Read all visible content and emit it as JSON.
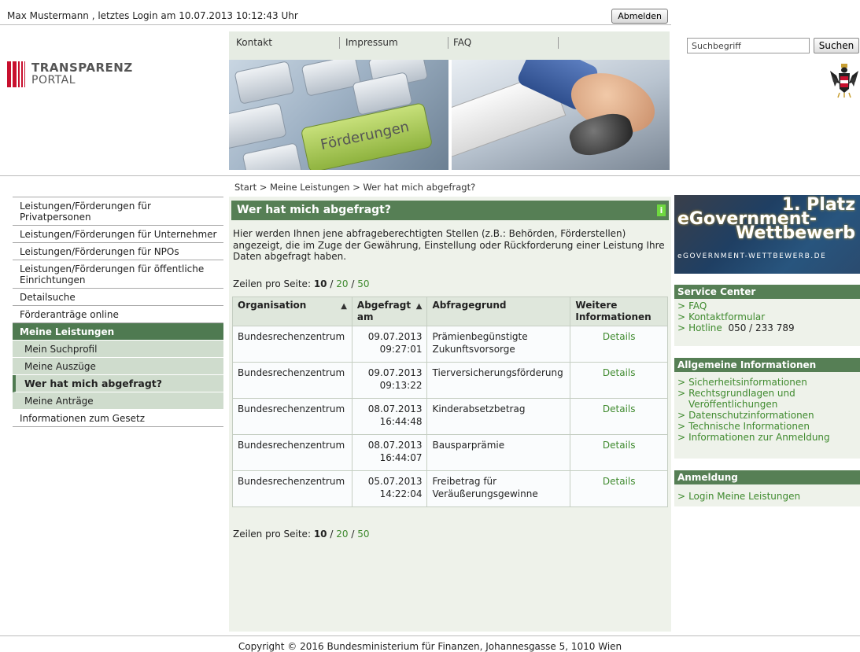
{
  "topbar": {
    "user_info": "Max Mustermann , letztes Login am 10.07.2013 10:12:43 Uhr",
    "logout_label": "Abmelden"
  },
  "logo": {
    "line1": "TRANSPARENZ",
    "line2": "PORTAL"
  },
  "header_nav": {
    "items": [
      "Kontakt",
      "Impressum",
      "FAQ"
    ]
  },
  "banner": {
    "key_label": "Förderungen"
  },
  "search": {
    "placeholder": "Suchbegriff",
    "button_label": "Suchen"
  },
  "breadcrumb": "Start > Meine Leistungen > Wer hat mich abgefragt?",
  "sidebar": {
    "items": [
      "Leistungen/Förderungen für Privatpersonen",
      "Leistungen/Förderungen für Unternehmer",
      "Leistungen/Förderungen für NPOs",
      "Leistungen/Förderungen für öffentliche Einrichtungen",
      "Detailsuche",
      "Förderanträge online",
      "Meine Leistungen",
      "Mein Suchprofil",
      "Meine Auszüge",
      "Wer hat mich abgefragt?",
      "Meine Anträge",
      "Informationen zum Gesetz"
    ]
  },
  "main": {
    "title": "Wer hat mich abgefragt?",
    "info_icon": "i",
    "intro": "Hier werden Ihnen jene abfrageberechtigten Stellen (z.B.: Behörden, Förderstellen) angezeigt, die im Zuge der Gewährung, Einstellung oder Rückforderung einer Leistung Ihre Daten abgefragt haben.",
    "rows_per_page_label": "Zeilen pro Seite:",
    "rows_options": [
      "10",
      "20",
      "50"
    ],
    "rows_separator": "/",
    "table": {
      "headers": [
        "Organisation",
        "Abgefragt am",
        "Abfragegrund",
        "Weitere Informationen"
      ],
      "rows": [
        {
          "org": "Bundesrechenzentrum",
          "date": "09.07.2013",
          "time": "09:27:01",
          "reason": "Prämienbegünstigte Zukunftsvorsorge",
          "details": "Details"
        },
        {
          "org": "Bundesrechenzentrum",
          "date": "09.07.2013",
          "time": "09:13:22",
          "reason": "Tierversicherungsförderung",
          "details": "Details"
        },
        {
          "org": "Bundesrechenzentrum",
          "date": "08.07.2013",
          "time": "16:44:48",
          "reason": "Kinderabsetzbetrag",
          "details": "Details"
        },
        {
          "org": "Bundesrechenzentrum",
          "date": "08.07.2013",
          "time": "16:44:07",
          "reason": "Bausparprämie",
          "details": "Details"
        },
        {
          "org": "Bundesrechenzentrum",
          "date": "05.07.2013",
          "time": "14:22:04",
          "reason": "Freibetrag für Veräußerungsgewinne",
          "details": "Details"
        }
      ]
    }
  },
  "egov_banner": {
    "line1": "1. Platz",
    "line2": "eGovernment-",
    "line3": "Wettbewerb",
    "sub": "eGOVERNMENT-WETTBEWERB.DE"
  },
  "service_center": {
    "title": "Service Center",
    "links": [
      "FAQ",
      "Kontaktformular"
    ],
    "hotline_label": "Hotline",
    "hotline_number": "050 / 233 789"
  },
  "general_info": {
    "title": "Allgemeine Informationen",
    "links": [
      "Sicherheitsinformationen",
      "Rechtsgrundlagen und",
      "Veröffentlichungen",
      "Datenschutzinformationen",
      "Technische Informationen",
      "Informationen zur Anmeldung"
    ]
  },
  "login_box": {
    "title": "Anmeldung",
    "link": "Login Meine Leistungen"
  },
  "footer": "Copyright © 2016 Bundesministerium für Finanzen, Johannesgasse 5, 1010 Wien",
  "colors": {
    "accent_green": "#567f55",
    "link_green": "#3f8a2e",
    "panel_bg": "#eef2ea",
    "logo_red": "#c8102e"
  }
}
